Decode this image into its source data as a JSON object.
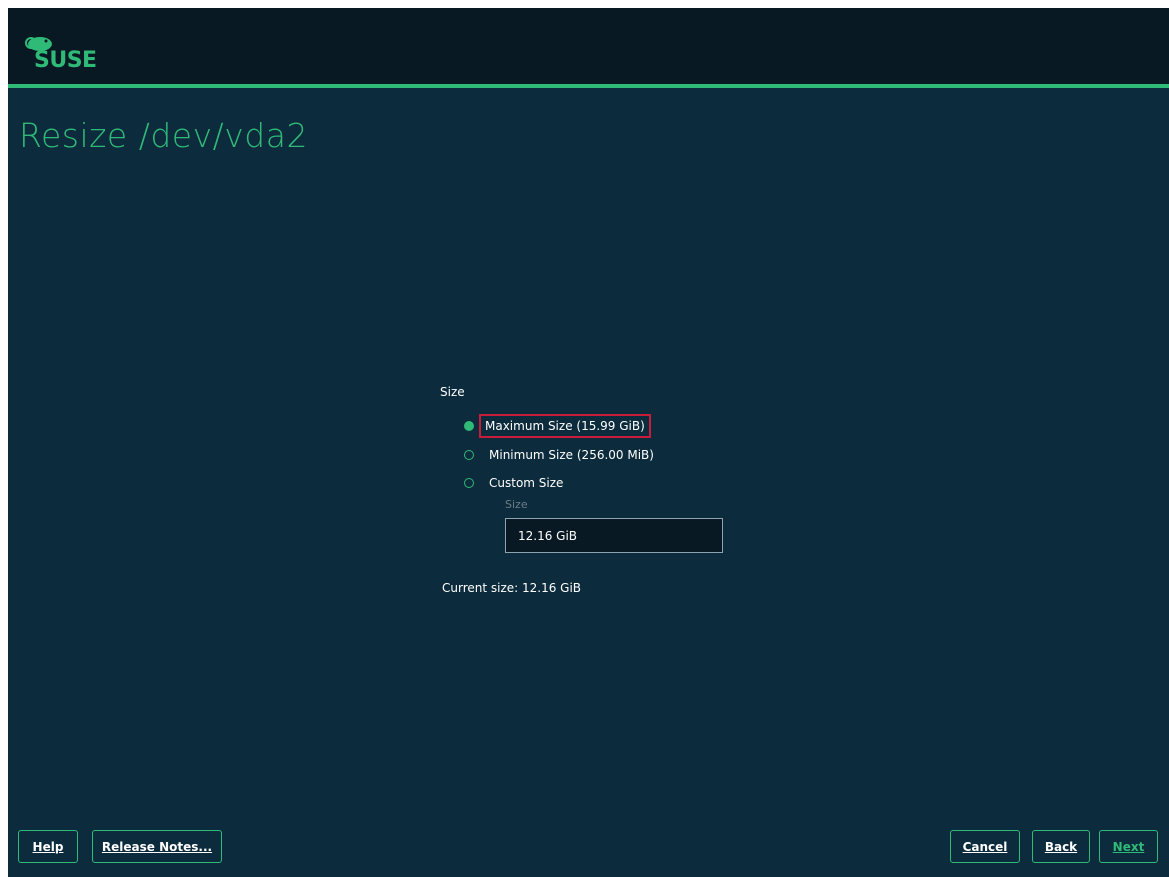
{
  "header": {
    "logo_text": "SUSE",
    "brand_color": "#30ba78"
  },
  "page": {
    "title": "Resize /dev/vda2"
  },
  "size_frame": {
    "label": "Size",
    "options": [
      {
        "label": "Maximum Size (15.99 GiB)",
        "selected": true,
        "focused": true
      },
      {
        "label": "Minimum Size (256.00 MiB)",
        "selected": false,
        "focused": false
      },
      {
        "label": "Custom Size",
        "selected": false,
        "focused": false
      }
    ],
    "custom_size_label": "Size",
    "custom_size_value": "12.16 GiB"
  },
  "current_size": "Current size: 12.16 GiB",
  "buttons": {
    "help": "Help",
    "release_notes": "Release Notes...",
    "cancel": "Cancel",
    "back": "Back",
    "next": "Next"
  }
}
